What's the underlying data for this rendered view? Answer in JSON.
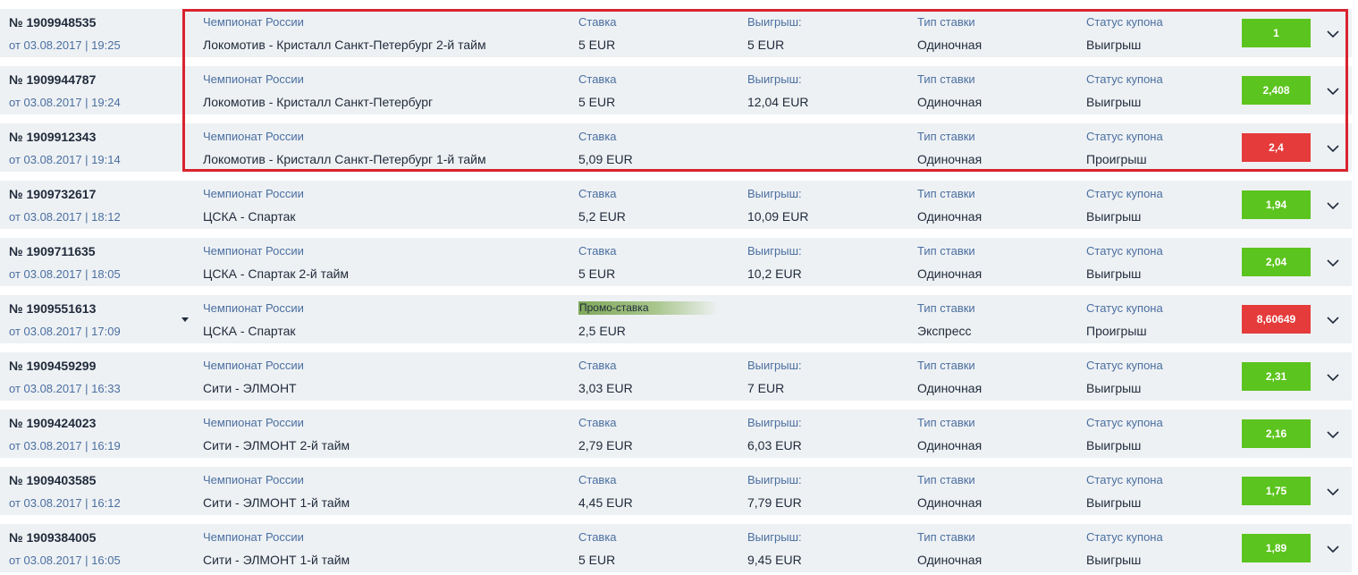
{
  "colors": {
    "win": "#5cc41e",
    "loss": "#e53b3b",
    "highlight": "#d8232f",
    "row_bg": "#eef1f4"
  },
  "icons": {
    "expand": "chevron-down-icon",
    "dropdown": "caret-down-icon"
  },
  "coupons": [
    {
      "number": "№ 1909948535",
      "date": "от 03.08.2017 | 19:25",
      "league": "Чемпионат России",
      "match": "Локомотив - Кристалл Санкт-Петербург 2-й тайм",
      "stake_label": "Ставка",
      "stake": "5 EUR",
      "win_label": "Выигрыш:",
      "win": "5 EUR",
      "type_label": "Тип ставки",
      "type": "Одиночная",
      "status_label": "Статус купона",
      "status": "Выигрыш",
      "odds": "1",
      "result": "win"
    },
    {
      "number": "№ 1909944787",
      "date": "от 03.08.2017 | 19:24",
      "league": "Чемпионат России",
      "match": "Локомотив - Кристалл Санкт-Петербург",
      "stake_label": "Ставка",
      "stake": "5 EUR",
      "win_label": "Выигрыш:",
      "win": "12,04 EUR",
      "type_label": "Тип ставки",
      "type": "Одиночная",
      "status_label": "Статус купона",
      "status": "Выигрыш",
      "odds": "2,408",
      "result": "win"
    },
    {
      "number": "№ 1909912343",
      "date": "от 03.08.2017 | 19:14",
      "league": "Чемпионат России",
      "match": "Локомотив - Кристалл Санкт-Петербург 1-й тайм",
      "stake_label": "Ставка",
      "stake": "5,09 EUR",
      "win_label": "",
      "win": "",
      "type_label": "Тип ставки",
      "type": "Одиночная",
      "status_label": "Статус купона",
      "status": "Проигрыш",
      "odds": "2,4",
      "result": "loss"
    },
    {
      "number": "№ 1909732617",
      "date": "от 03.08.2017 | 18:12",
      "league": "Чемпионат России",
      "match": "ЦСКА - Спартак",
      "stake_label": "Ставка",
      "stake": "5,2 EUR",
      "win_label": "Выигрыш:",
      "win": "10,09 EUR",
      "type_label": "Тип ставки",
      "type": "Одиночная",
      "status_label": "Статус купона",
      "status": "Выигрыш",
      "odds": "1,94",
      "result": "win"
    },
    {
      "number": "№ 1909711635",
      "date": "от 03.08.2017 | 18:05",
      "league": "Чемпионат России",
      "match": "ЦСКА - Спартак 2-й тайм",
      "stake_label": "Ставка",
      "stake": "5 EUR",
      "win_label": "Выигрыш:",
      "win": "10,2 EUR",
      "type_label": "Тип ставки",
      "type": "Одиночная",
      "status_label": "Статус купона",
      "status": "Выигрыш",
      "odds": "2,04",
      "result": "win"
    },
    {
      "number": "№ 1909551613",
      "date": "от 03.08.2017 | 17:09",
      "league": "Чемпионат России",
      "match": "ЦСКА - Спартак",
      "promo": "Промо-ставка",
      "stake": "2,5 EUR",
      "win_label": "",
      "win": "",
      "type_label": "Тип ставки",
      "type": "Экспресс",
      "status_label": "Статус купона",
      "status": "Проигрыш",
      "odds": "8,60649",
      "result": "loss",
      "has_dropdown": true
    },
    {
      "number": "№ 1909459299",
      "date": "от 03.08.2017 | 16:33",
      "league": "Чемпионат России",
      "match": "Сити - ЭЛМОНТ",
      "stake_label": "Ставка",
      "stake": "3,03 EUR",
      "win_label": "Выигрыш:",
      "win": "7 EUR",
      "type_label": "Тип ставки",
      "type": "Одиночная",
      "status_label": "Статус купона",
      "status": "Выигрыш",
      "odds": "2,31",
      "result": "win"
    },
    {
      "number": "№ 1909424023",
      "date": "от 03.08.2017 | 16:19",
      "league": "Чемпионат России",
      "match": "Сити - ЭЛМОНТ 2-й тайм",
      "stake_label": "Ставка",
      "stake": "2,79 EUR",
      "win_label": "Выигрыш:",
      "win": "6,03 EUR",
      "type_label": "Тип ставки",
      "type": "Одиночная",
      "status_label": "Статус купона",
      "status": "Выигрыш",
      "odds": "2,16",
      "result": "win"
    },
    {
      "number": "№ 1909403585",
      "date": "от 03.08.2017 | 16:12",
      "league": "Чемпионат России",
      "match": "Сити - ЭЛМОНТ 1-й тайм",
      "stake_label": "Ставка",
      "stake": "4,45 EUR",
      "win_label": "Выигрыш:",
      "win": "7,79 EUR",
      "type_label": "Тип ставки",
      "type": "Одиночная",
      "status_label": "Статус купона",
      "status": "Выигрыш",
      "odds": "1,75",
      "result": "win"
    },
    {
      "number": "№ 1909384005",
      "date": "от 03.08.2017 | 16:05",
      "league": "Чемпионат России",
      "match": "Сити - ЭЛМОНТ 1-й тайм",
      "stake_label": "Ставка",
      "stake": "5 EUR",
      "win_label": "Выигрыш:",
      "win": "9,45 EUR",
      "type_label": "Тип ставки",
      "type": "Одиночная",
      "status_label": "Статус купона",
      "status": "Выигрыш",
      "odds": "1,89",
      "result": "win"
    }
  ]
}
